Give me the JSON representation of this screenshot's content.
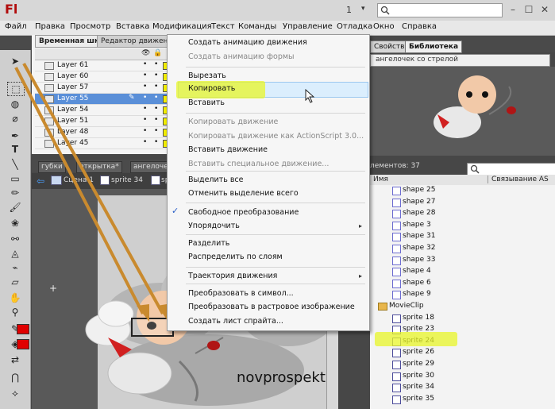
{
  "titlebar": {
    "logo": "Fl",
    "page_number": "1",
    "page_chevron": "▾"
  },
  "menubar": {
    "items": [
      "Файл",
      "Правка",
      "Просмотр",
      "Вставка",
      "Модификация",
      "Текст",
      "Команды",
      "Управление",
      "Отладка",
      "Окно",
      "Справка"
    ]
  },
  "timeline": {
    "tabs": [
      "Временная шкала",
      "Редактор движения"
    ],
    "layers": [
      {
        "name": "Layer 61",
        "selected": false
      },
      {
        "name": "Layer 60",
        "selected": false
      },
      {
        "name": "Layer 57",
        "selected": false
      },
      {
        "name": "Layer 55",
        "selected": true
      },
      {
        "name": "Layer 54",
        "selected": false
      },
      {
        "name": "Layer 51",
        "selected": false
      },
      {
        "name": "Layer 48",
        "selected": false
      },
      {
        "name": "Layer 45",
        "selected": false
      }
    ]
  },
  "doc_tabs": [
    "губки",
    "открытка*",
    "ангелоче"
  ],
  "breadcrumb": {
    "scene": "Сцена 1",
    "symbol": "sprite 34",
    "extra": "sp"
  },
  "stage": {
    "watermark": "novprospekt"
  },
  "context_menu": {
    "items": [
      {
        "label": "Создать анимацию движения",
        "disabled": false
      },
      {
        "label": "Создать анимацию формы",
        "disabled": true
      },
      {
        "label": "Вырезать",
        "disabled": false
      },
      {
        "label": "Копировать",
        "disabled": false
      },
      {
        "label": "Вставить",
        "disabled": false
      },
      {
        "label": "Копировать движение",
        "disabled": true
      },
      {
        "label": "Копировать движение как ActionScript 3.0...",
        "disabled": true
      },
      {
        "label": "Вставить движение",
        "disabled": false
      },
      {
        "label": "Вставить специальное движение...",
        "disabled": true
      },
      {
        "label": "Выделить все",
        "disabled": false
      },
      {
        "label": "Отменить выделение всего",
        "disabled": false
      },
      {
        "label": "Свободное преобразование",
        "disabled": false
      },
      {
        "label": "Упорядочить",
        "disabled": false
      },
      {
        "label": "Разделить",
        "disabled": false
      },
      {
        "label": "Распределить по слоям",
        "disabled": false
      },
      {
        "label": "Траектория движения",
        "disabled": false
      },
      {
        "label": "Преобразовать в символ...",
        "disabled": false
      },
      {
        "label": "Преобразовать в растровое изображение",
        "disabled": false
      },
      {
        "label": "Создать лист спрайта...",
        "disabled": false
      }
    ],
    "submenu_arrow": "▸",
    "checkmark": "✓"
  },
  "library": {
    "tabs": [
      "Свойства",
      "Библиотека"
    ],
    "dropdown": "ангелочек со стрелой",
    "count_text": "лементов: 37",
    "columns": [
      "Имя",
      "Связывание AS"
    ],
    "items": [
      {
        "name": "shape 25",
        "type": "shape"
      },
      {
        "name": "shape 27",
        "type": "shape"
      },
      {
        "name": "shape 28",
        "type": "shape"
      },
      {
        "name": "shape 3",
        "type": "shape"
      },
      {
        "name": "shape 31",
        "type": "shape"
      },
      {
        "name": "shape 32",
        "type": "shape"
      },
      {
        "name": "shape 33",
        "type": "shape"
      },
      {
        "name": "shape 4",
        "type": "shape"
      },
      {
        "name": "shape 6",
        "type": "shape"
      },
      {
        "name": "shape 9",
        "type": "shape"
      },
      {
        "name": "MovieClip",
        "type": "folder"
      },
      {
        "name": "sprite 18",
        "type": "sprite"
      },
      {
        "name": "sprite 23",
        "type": "sprite"
      },
      {
        "name": "sprite 24",
        "type": "sprite"
      },
      {
        "name": "sprite 26",
        "type": "sprite"
      },
      {
        "name": "sprite 29",
        "type": "sprite"
      },
      {
        "name": "sprite 30",
        "type": "sprite"
      },
      {
        "name": "sprite 34",
        "type": "sprite"
      },
      {
        "name": "sprite 35",
        "type": "sprite"
      }
    ]
  },
  "colors": {
    "accent": "#5a8fd8",
    "highlight": "#e8f528",
    "stroke": "#e00000",
    "fill": "#e00000"
  }
}
